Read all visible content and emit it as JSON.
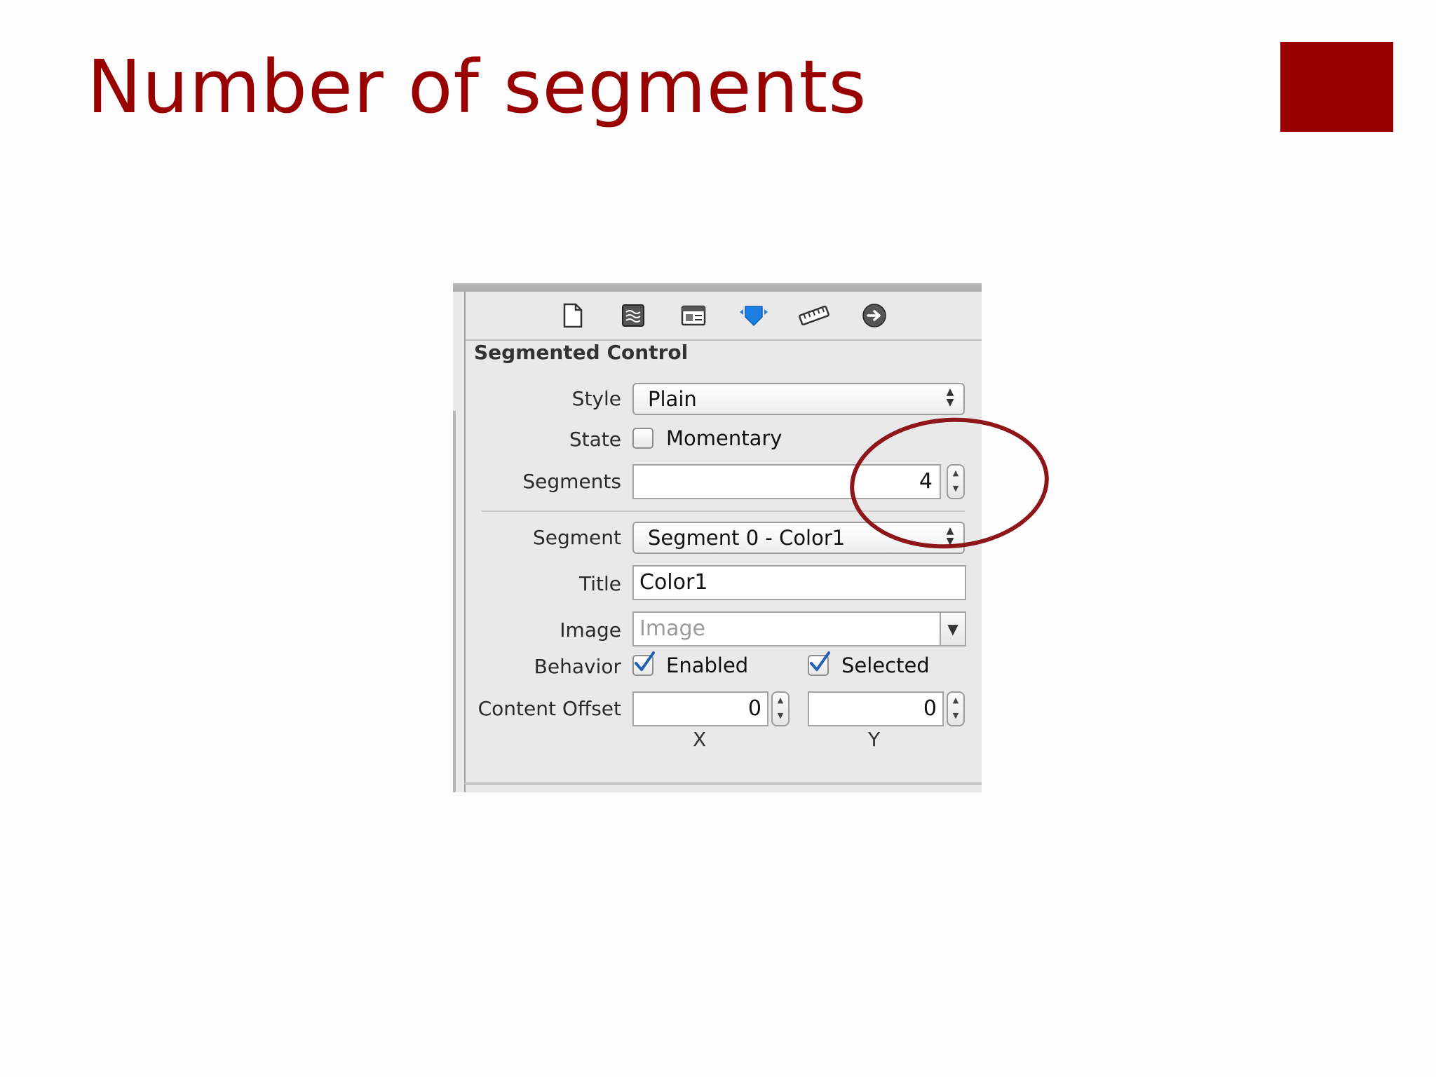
{
  "slide": {
    "title": "Number of segments",
    "accent_color": "#990000"
  },
  "inspector": {
    "toolbar_icons": [
      "file-inspector-icon",
      "quick-help-icon",
      "identity-inspector-icon",
      "attributes-inspector-icon",
      "size-inspector-icon",
      "connections-inspector-icon"
    ],
    "active_icon": "attributes-inspector-icon",
    "section_title": "Segmented Control",
    "style": {
      "label": "Style",
      "value": "Plain"
    },
    "state": {
      "label": "State",
      "option": "Momentary",
      "checked": false
    },
    "segments": {
      "label": "Segments",
      "value": "4"
    },
    "segment": {
      "label": "Segment",
      "value": "Segment 0 - Color1"
    },
    "title": {
      "label": "Title",
      "value": "Color1"
    },
    "image": {
      "label": "Image",
      "placeholder": "Image"
    },
    "behavior": {
      "label": "Behavior",
      "enabled_label": "Enabled",
      "enabled_checked": true,
      "selected_label": "Selected",
      "selected_checked": true
    },
    "content_offset": {
      "label": "Content Offset",
      "x_value": "0",
      "y_value": "0",
      "x_label": "X",
      "y_label": "Y"
    }
  },
  "annotation": {
    "color": "#8e1518",
    "highlights": "segments"
  }
}
